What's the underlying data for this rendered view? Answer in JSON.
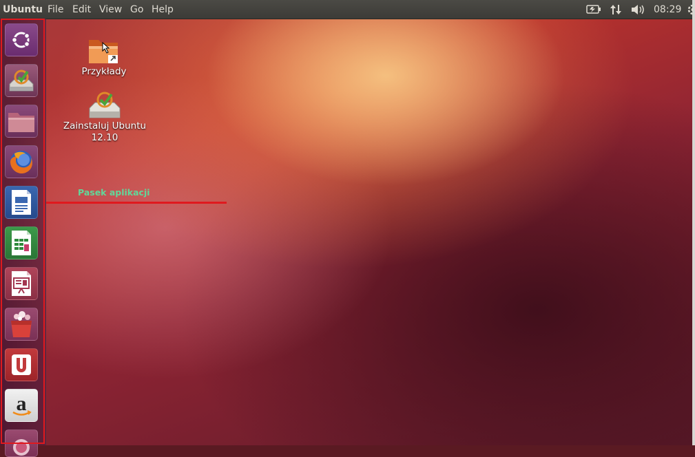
{
  "topbar": {
    "app_title": "Ubuntu",
    "menus": [
      "File",
      "Edit",
      "View",
      "Go",
      "Help"
    ],
    "clock": "08:29",
    "tray_icons": [
      "battery-icon",
      "network-icon",
      "volume-icon",
      "gear-icon"
    ]
  },
  "launcher": {
    "items": [
      "dash-home-icon",
      "install-ubuntu-icon",
      "files-icon",
      "firefox-icon",
      "libreoffice-writer-icon",
      "libreoffice-calc-icon",
      "libreoffice-impress-icon",
      "software-center-icon",
      "ubuntu-one-icon",
      "amazon-icon",
      "update-manager-icon"
    ]
  },
  "desktop": {
    "icons": [
      {
        "label": "Przykłady",
        "icon": "examples-folder-icon"
      },
      {
        "label": "Zainstaluj Ubuntu 12.10",
        "icon": "install-drive-icon"
      }
    ]
  },
  "annotation": {
    "text": "Pasek aplikacji"
  },
  "colors": {
    "topbar": "#3c3b37",
    "launcher_outline": "#e0191e",
    "annotation_text": "#61d89a",
    "annotation_line": "#e0191e"
  }
}
